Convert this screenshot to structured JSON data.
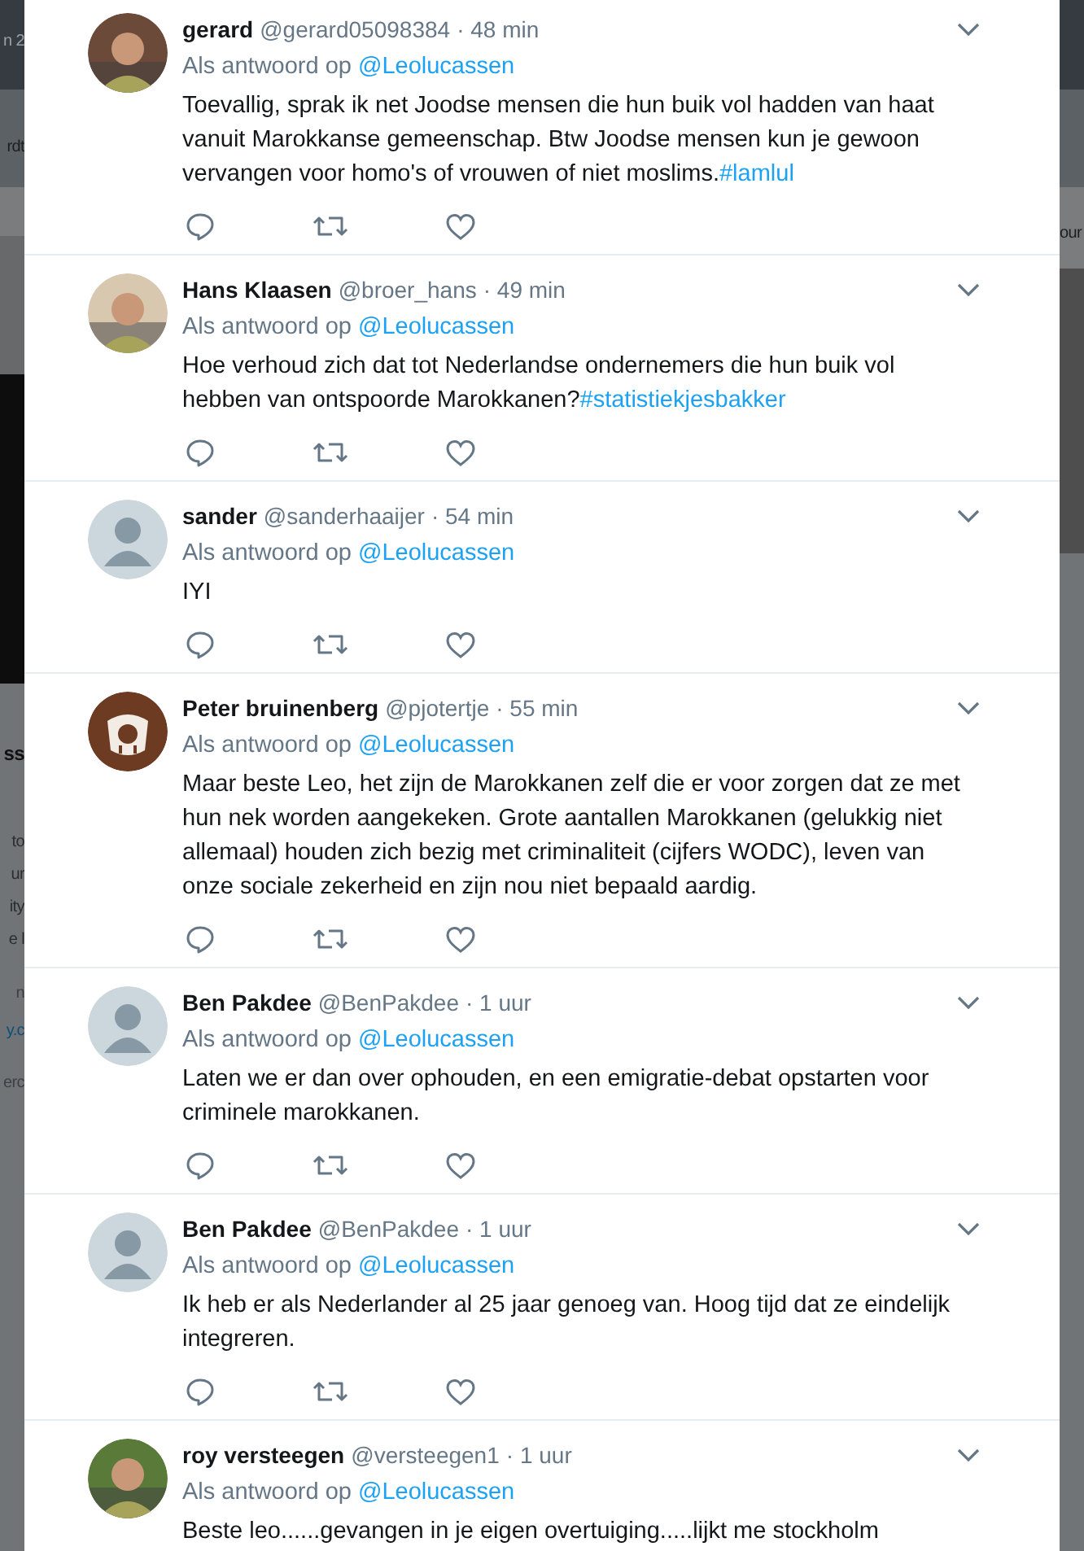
{
  "backdrop": {
    "left_fragments": [
      {
        "text": "n 2",
        "kind": "header"
      },
      {
        "text": "rdt",
        "kind": "nav"
      },
      {
        "text": "ss",
        "kind": "title"
      },
      {
        "text": "to",
        "kind": "body"
      },
      {
        "text": "ur",
        "kind": "body"
      },
      {
        "text": "ity",
        "kind": "body"
      },
      {
        "text": "e l",
        "kind": "body"
      },
      {
        "text": "n",
        "kind": "meta"
      },
      {
        "text": "y.c",
        "kind": "link"
      },
      {
        "text": "erc",
        "kind": "meta"
      }
    ],
    "right_fragments": [
      {
        "text": "our",
        "kind": "nav"
      }
    ]
  },
  "tweets": [
    {
      "name": "gerard",
      "handle": "@gerard05098384",
      "time": "· 48 min",
      "reply_prefix": "Als antwoord op",
      "reply_to": "@Leolucassen",
      "text": "Toevallig, sprak ik net Joodse mensen die hun buik vol hadden van haat vanuit Marokkanse gemeenschap. Btw Joodse mensen kun je gewoon vervangen voor homo's of vrouwen of niet moslims.",
      "hashtag": "#lamlul",
      "actions": true
    },
    {
      "name": "Hans Klaasen",
      "handle": "@broer_hans",
      "time": "· 49 min",
      "reply_prefix": "Als antwoord op",
      "reply_to": "@Leolucassen",
      "text": "Hoe verhoud zich dat tot Nederlandse ondernemers die hun buik vol hebben van ontspoorde Marokkanen?",
      "hashtag": "#statistiekjesbakker",
      "actions": true
    },
    {
      "name": "sander",
      "handle": "@sanderhaaijer",
      "time": "· 54 min",
      "avatar": {
        "kind": "default"
      },
      "reply_prefix": "Als antwoord op",
      "reply_to": "@Leolucassen",
      "text": "IYI",
      "actions": true
    },
    {
      "name": "Peter bruinenberg",
      "handle": "@pjotertje",
      "time": "· 55 min",
      "avatar": {
        "kind": "sheep"
      },
      "reply_prefix": "Als antwoord op",
      "reply_to": "@Leolucassen",
      "text": "Maar beste Leo, het zijn de Marokkanen zelf die er voor zorgen dat ze met hun nek worden aangekeken. Grote aantallen Marokkanen (gelukkig niet allemaal) houden zich bezig met criminaliteit (cijfers WODC), leven van onze sociale zekerheid en zijn nou niet bepaald aardig.",
      "actions": true
    },
    {
      "name": "Ben Pakdee",
      "handle": "@BenPakdee",
      "time": "· 1 uur",
      "avatar": {
        "kind": "default"
      },
      "reply_prefix": "Als antwoord op",
      "reply_to": "@Leolucassen",
      "text": "Laten we er dan over ophouden, en een emigratie-debat opstarten voor criminele marokkanen.",
      "actions": true
    },
    {
      "name": "Ben Pakdee",
      "handle": "@BenPakdee",
      "time": "· 1 uur",
      "avatar": {
        "kind": "default"
      },
      "reply_prefix": "Als antwoord op",
      "reply_to": "@Leolucassen",
      "text": "Ik heb er als Nederlander al 25 jaar genoeg van. Hoog tijd dat ze eindelijk integreren.",
      "actions": true
    },
    {
      "name": "roy versteegen",
      "handle": "@versteegen1",
      "time": "· 1 uur",
      "reply_prefix": "Als antwoord op",
      "reply_to": "@Leolucassen",
      "text": "Beste leo......gevangen in je eigen overtuiging.....lijkt me stockholm",
      "actions": false
    }
  ]
}
